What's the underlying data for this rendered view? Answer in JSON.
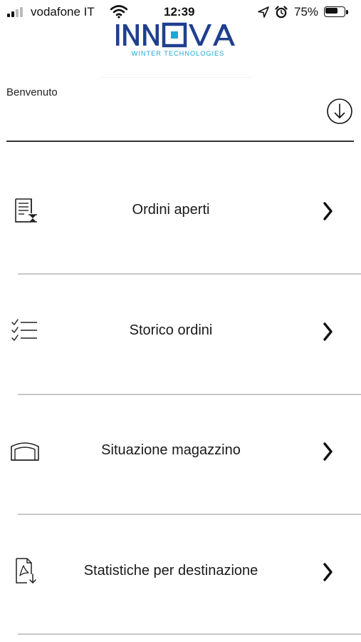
{
  "status_bar": {
    "carrier": "vodafone IT",
    "time": "12:39",
    "battery_percent_label": "75%",
    "battery_level": 0.75,
    "icons": [
      "signal-icon",
      "wifi-icon",
      "location-arrow-icon",
      "alarm-icon",
      "battery-icon"
    ]
  },
  "logo": {
    "brand": "INNOVA",
    "tagline": "WINTER TECHNOLOGIES",
    "colors": {
      "navy": "#1f3f8f",
      "cyan": "#1aa6dc"
    }
  },
  "header": {
    "welcome": "Benvenuto",
    "download_icon": "download-circle-icon"
  },
  "menu": {
    "items": [
      {
        "label": "Ordini aperti",
        "icon": "open-orders-icon"
      },
      {
        "label": "Storico ordini",
        "icon": "checklist-icon"
      },
      {
        "label": "Situazione magazzino",
        "icon": "warehouse-icon"
      },
      {
        "label": "Statistiche per destinazione",
        "icon": "pdf-download-icon"
      }
    ],
    "chevron_icon": "chevron-right-icon"
  },
  "colors": {
    "text": "#1a1a1a",
    "divider": "#c8c8c8",
    "header_divider": "#333333",
    "background": "#ffffff"
  }
}
